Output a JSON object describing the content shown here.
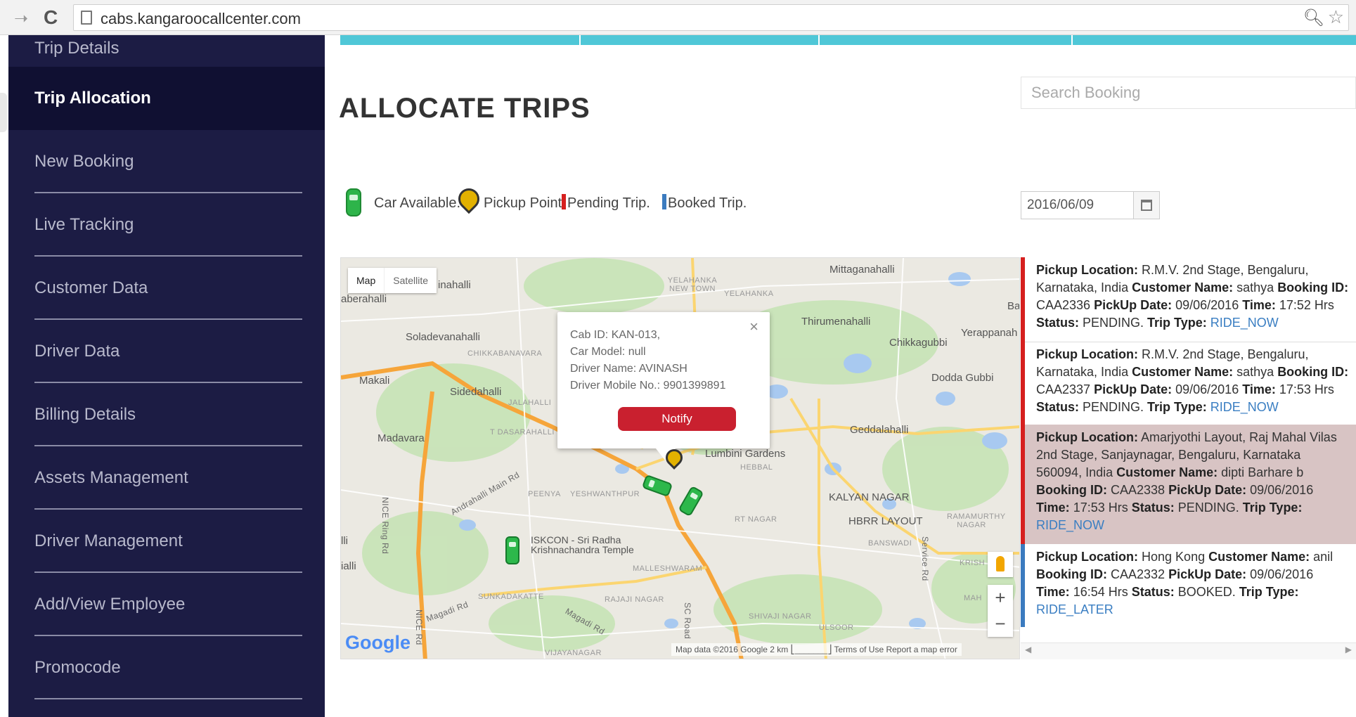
{
  "browser": {
    "url": "cabs.kangaroocallcenter.com"
  },
  "sidebar": {
    "items": [
      {
        "label": "Trip Details"
      },
      {
        "label": "Trip Allocation"
      },
      {
        "label": "New Booking"
      },
      {
        "label": "Live Tracking"
      },
      {
        "label": "Customer Data"
      },
      {
        "label": "Driver Data"
      },
      {
        "label": "Billing Details"
      },
      {
        "label": "Assets Management"
      },
      {
        "label": "Driver Management"
      },
      {
        "label": "Add/View Employee"
      },
      {
        "label": "Promocode"
      }
    ],
    "active_index": 1
  },
  "main": {
    "title": "ALLOCATE TRIPS",
    "search_placeholder": "Search Booking",
    "legend": {
      "car_available": "Car Available.",
      "pickup_point": "Pickup Point.",
      "pending_trip": "Pending Trip.",
      "booked_trip": "Booked Trip."
    },
    "date": "2016/06/09"
  },
  "map": {
    "type_map": "Map",
    "type_satellite": "Satellite",
    "labels": {
      "mittaganahalli": "Mittaganahalli",
      "thirumenahalli": "Thirumenahalli",
      "yerappanah": "Yerappanah",
      "chikkagubbi": "Chikkagubbi",
      "dodda_gubbi": "Dodda Gubbi",
      "soladevanahalli": "Soladevanahalli",
      "makali": "Makali",
      "sidedahalli": "Sidedahalli",
      "madavara": "Madavara",
      "geddalahalli": "Geddalahalli",
      "lumbini": "Lumbini Gardens",
      "kalyan": "KALYAN NAGAR",
      "hbr": "HBRR LAYOUT",
      "iskcon": "ISKCON - Sri Radha Krishnachandra Temple",
      "yelahanka_nt": "YELAHANKA NEW TOWN",
      "yelahanka": "YELAHANKA",
      "chikkabanavara": "CHIKKABANAVARA",
      "jalahalli": "JALAHALLI",
      "t_dasarahalli": "T DASARAHALLI",
      "hebbal": "HEBBAL",
      "rt_nagar": "RT NAGAR",
      "peenya": "PEENYA",
      "yeshwanthpur": "YESHWANTHPUR",
      "malleshwaram": "MALLESHWARAM",
      "banswadi": "BANSWADI",
      "ramamurthy": "RAMAMURTHY NAGAR",
      "sunkadakatte": "SUNKADAKATTE",
      "rajaji": "RAJAJI NAGAR",
      "shivaji": "SHIVAJI NAGAR",
      "vijayanagar": "VIJAYANAGAR",
      "ulsoor": "ULSOOR",
      "nice_road": "NICE Ring Rd",
      "nice_road2": "NICE Rd",
      "magadi": "Magadi Rd",
      "magadi2": "Magadi Rd",
      "andrahalli": "Andrahalli Main Rd",
      "sc_road": "SC Road",
      "service_rd": "Service Rd",
      "inahalli": "inahalli",
      "aberahalli": "aberahalli",
      "lli": "lli",
      "ialli": "ialli",
      "krishi": "KRISH",
      "mah": "MAH",
      "ba": "Ba"
    },
    "popup": {
      "cab_id": "Cab ID: KAN-013,",
      "car_model": "Car Model: null",
      "driver_name": "Driver Name: AVINASH",
      "driver_mobile": "Driver Mobile No.: 9901399891",
      "notify_label": "Notify",
      "close": "×"
    },
    "zoom_in": "+",
    "zoom_out": "−",
    "logo": "Google",
    "attribution": "Map data ©2016 Google   2 km ⎣_______⎦   Terms of Use   Report a map error"
  },
  "trips": [
    {
      "status_kind": "pending",
      "pickup_label": "Pickup Location:",
      "pickup": " R.M.V. 2nd Stage, Bengaluru, Karnataka, India ",
      "customer_label": "Customer Name:",
      "customer": " sathya ",
      "booking_label": "Booking ID:",
      "booking": " CAA2336 ",
      "date_label": "PickUp Date:",
      "date": " 09/06/2016 ",
      "time_label": "Time:",
      "time": " 17:52 Hrs ",
      "status_label": "Status:",
      "status": " PENDING. ",
      "type_label": "Trip Type:",
      "type": "RIDE_NOW"
    },
    {
      "status_kind": "pending",
      "pickup_label": "Pickup Location:",
      "pickup": " R.M.V. 2nd Stage, Bengaluru, Karnataka, India ",
      "customer_label": "Customer Name:",
      "customer": " sathya ",
      "booking_label": "Booking ID:",
      "booking": " CAA2337 ",
      "date_label": "PickUp Date:",
      "date": " 09/06/2016 ",
      "time_label": "Time:",
      "time": " 17:53 Hrs ",
      "status_label": "Status:",
      "status": " PENDING. ",
      "type_label": "Trip Type:",
      "type": "RIDE_NOW"
    },
    {
      "status_kind": "pending",
      "pickup_label": "Pickup Location:",
      "pickup": " Amarjyothi Layout, Raj Mahal Vilas 2nd Stage, Sanjaynagar, Bengaluru, Karnataka 560094, India ",
      "customer_label": "Customer Name:",
      "customer": " dipti Barhare b ",
      "booking_label": "Booking ID:",
      "booking": " CAA2338 ",
      "date_label": "PickUp Date:",
      "date": " 09/06/2016 ",
      "time_label": "Time:",
      "time": " 17:53 Hrs ",
      "status_label": "Status:",
      "status": " PENDING. ",
      "type_label": "Trip Type:",
      "type": "RIDE_NOW"
    },
    {
      "status_kind": "booked",
      "pickup_label": "Pickup Location:",
      "pickup": " Hong Kong ",
      "customer_label": "Customer Name:",
      "customer": " anil ",
      "booking_label": "Booking ID:",
      "booking": " CAA2332 ",
      "date_label": "PickUp Date:",
      "date": " 09/06/2016 ",
      "time_label": "Time:",
      "time": " 16:54 Hrs ",
      "status_label": "Status:",
      "status": " BOOKED. ",
      "type_label": "Trip Type:",
      "type": "RIDE_LATER"
    }
  ],
  "colors": {
    "sidebar_bg": "#1c1c44",
    "sidebar_active": "#101032",
    "accent_strip": "#4fc7d7",
    "pending": "#d6201f",
    "booked": "#3b7bbf",
    "notify": "#c9202f",
    "car_green": "#2db84b"
  }
}
